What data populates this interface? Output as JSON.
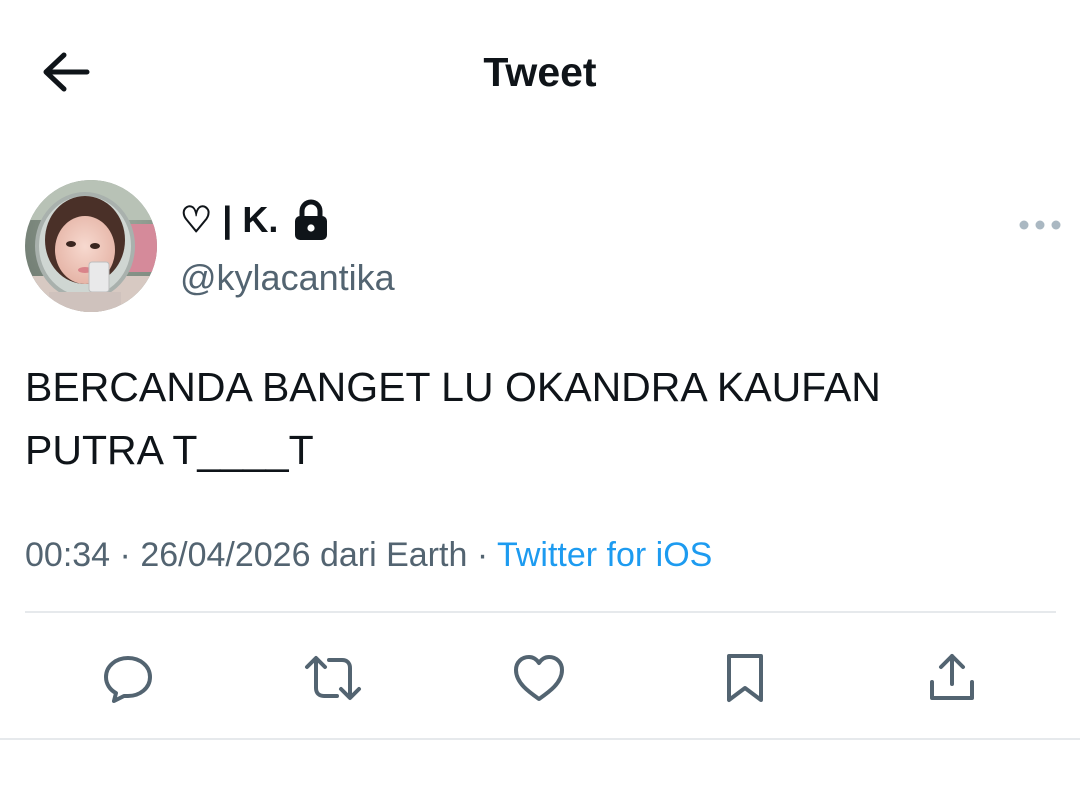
{
  "header": {
    "title": "Tweet",
    "back_icon": "arrow-left-icon"
  },
  "author": {
    "display_name": "♡ | K.",
    "handle": "@kylacantika",
    "protected_icon": "lock-icon",
    "avatar_icon": "avatar"
  },
  "tweet": {
    "text": "BERCANDA BANGET LU OKANDRA KAUFAN\nPUTRA T____T",
    "time": "00:34",
    "date": "26/04/2026",
    "location": "dari Earth",
    "separator": "·",
    "source": "Twitter for iOS"
  },
  "actions": {
    "reply_icon": "reply-icon",
    "retweet_icon": "retweet-icon",
    "like_icon": "heart-icon",
    "bookmark_icon": "bookmark-icon",
    "share_icon": "share-icon"
  },
  "colors": {
    "text": "#0f1419",
    "secondary": "#536471",
    "link": "#1d9bf0",
    "divider": "#e6e9ec"
  }
}
